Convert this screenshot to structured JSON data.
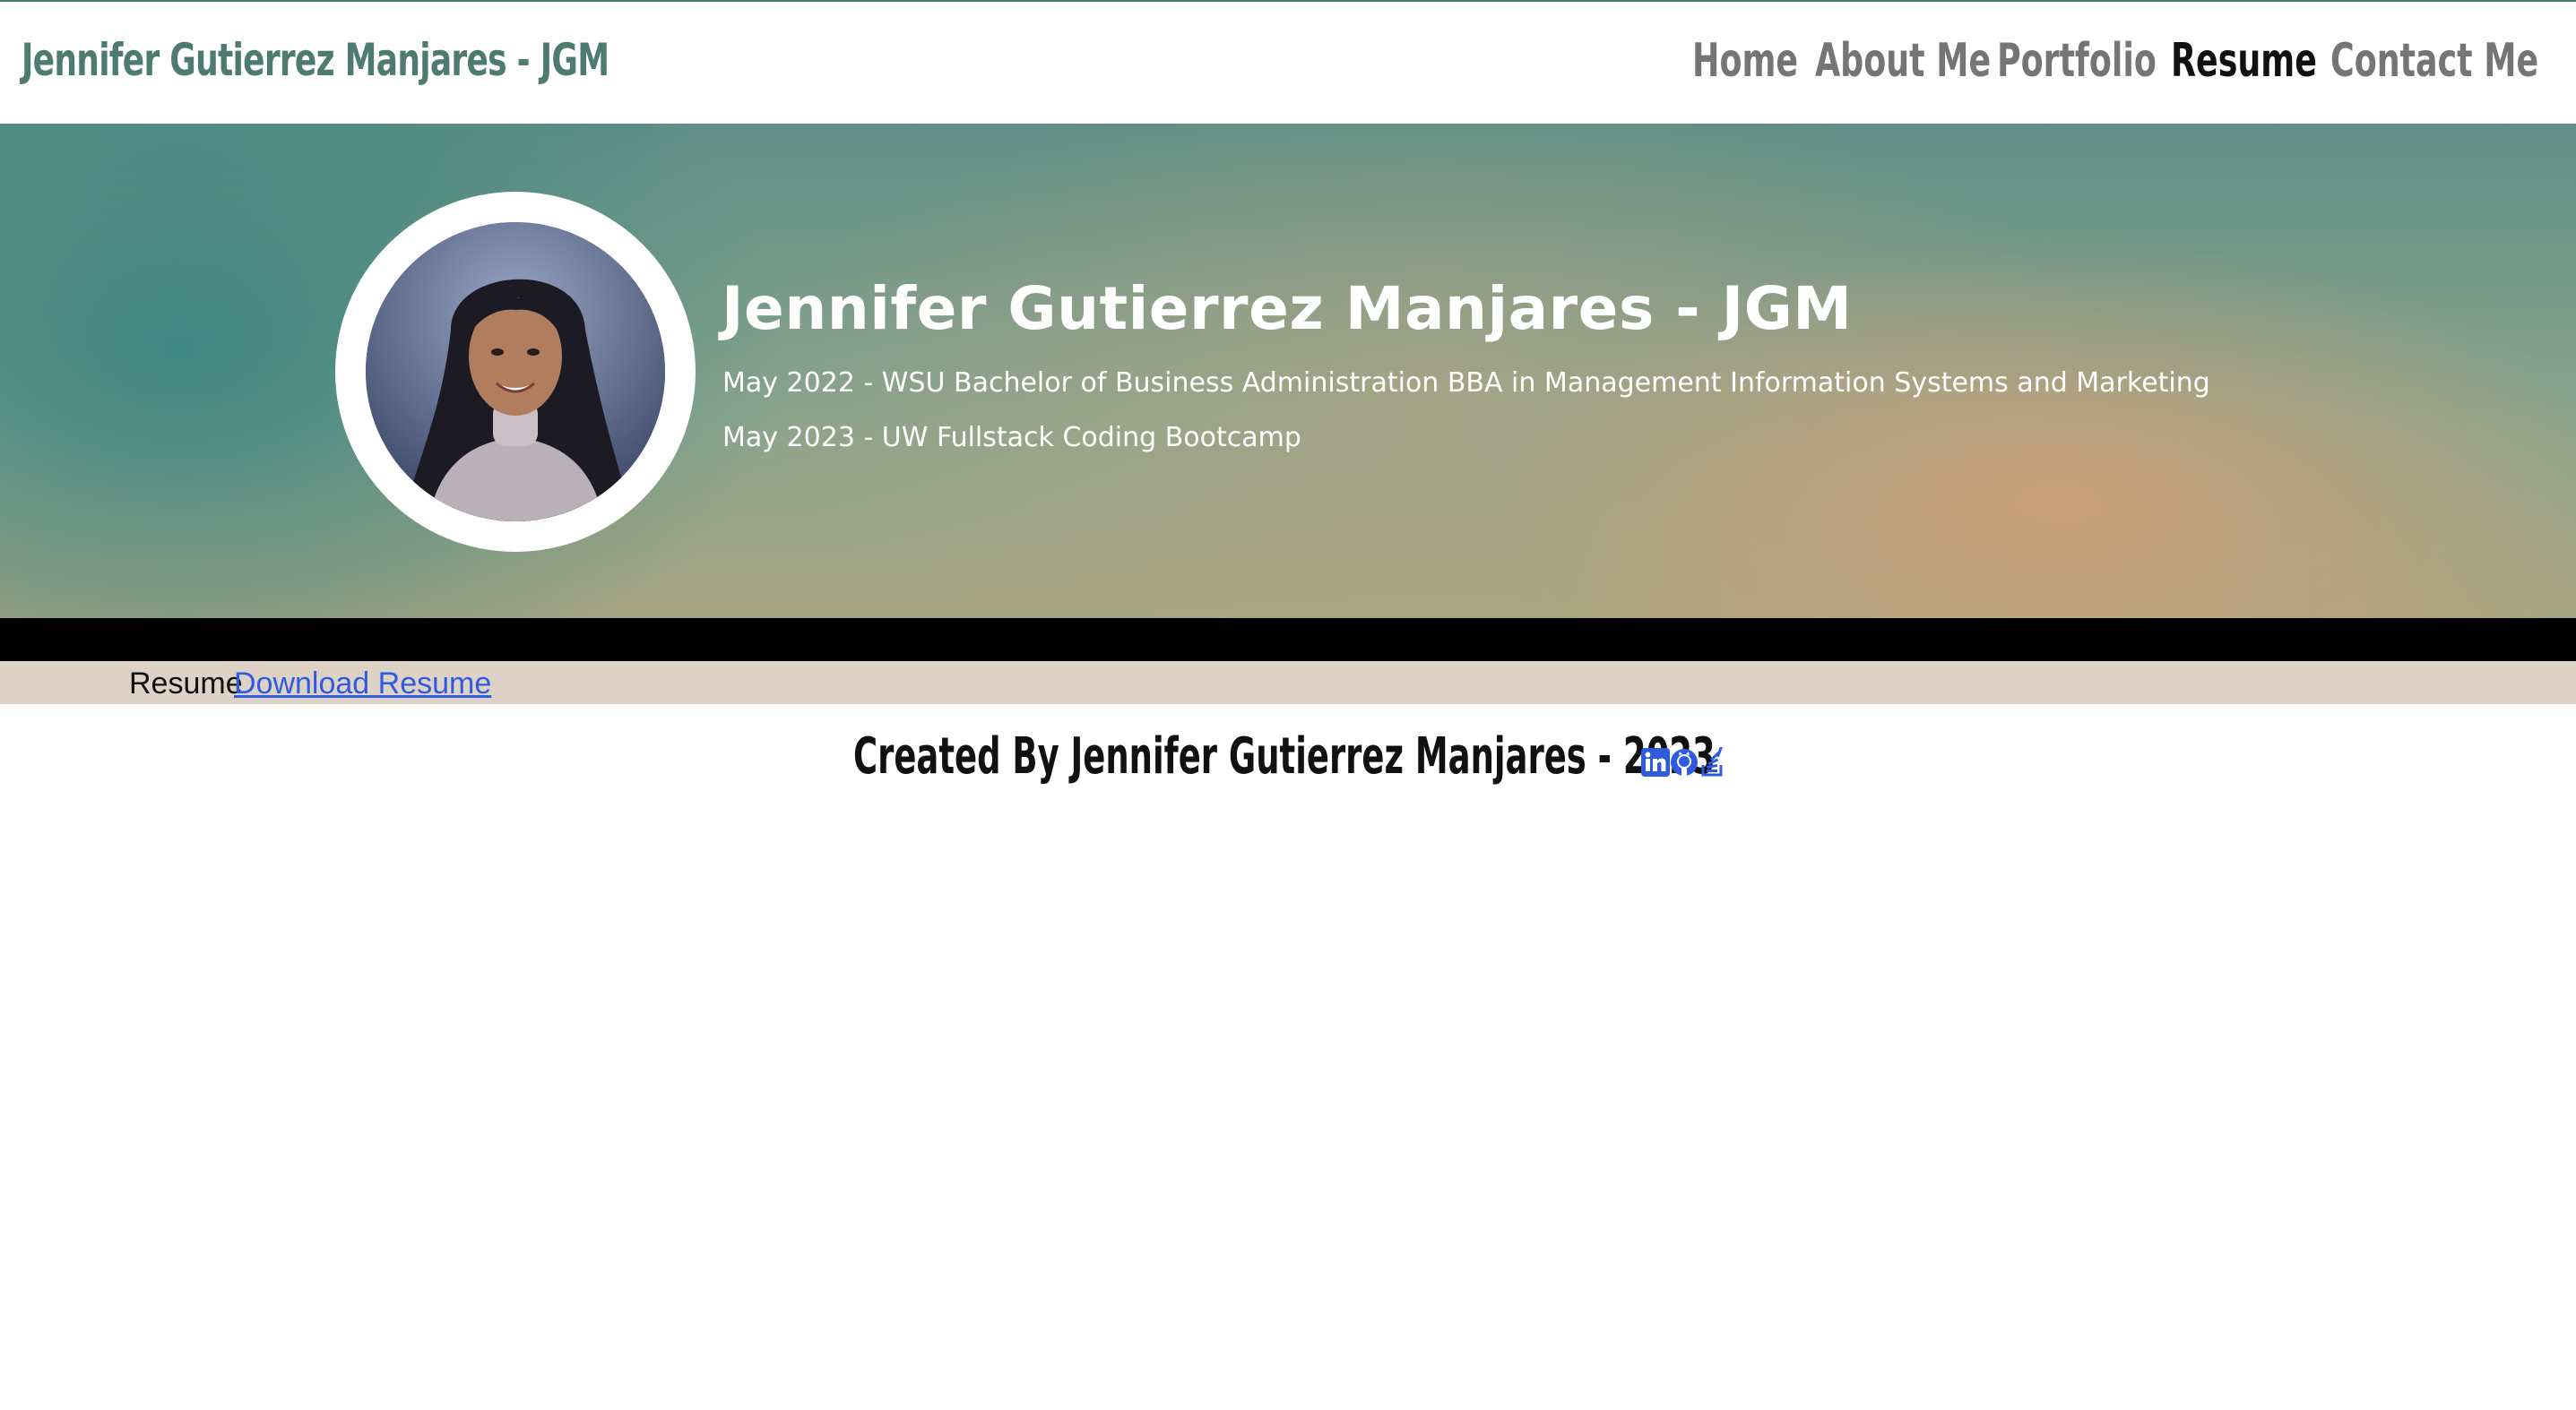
{
  "nav": {
    "brand": "Jennifer Gutierrez Manjares - JGM",
    "links": [
      {
        "label": "Home",
        "active": false
      },
      {
        "label": "About Me",
        "active": false
      },
      {
        "label": "Portfolio",
        "active": false
      },
      {
        "label": "Resume",
        "active": true
      },
      {
        "label": "Contact Me",
        "active": false
      }
    ]
  },
  "hero": {
    "title": "Jennifer Gutierrez Manjares - JGM",
    "education": [
      "May 2022 - WSU Bachelor of Business Administration BBA in Management Information Systems and Marketing",
      "May 2023 - UW Fullstack Coding Bootcamp"
    ]
  },
  "resume": {
    "label": "Resume",
    "download_label": "Download Resume"
  },
  "footer": {
    "text": "Created By Jennifer Gutierrez Manjares - 2023",
    "social": [
      {
        "name": "linkedin-icon"
      },
      {
        "name": "github-icon"
      },
      {
        "name": "stackoverflow-icon"
      }
    ]
  },
  "colors": {
    "brand": "#4d7b6f",
    "nav_inactive": "#757575",
    "nav_active": "#111111",
    "link": "#2e5be0",
    "resume_bar": "#ddd2c5",
    "social_icon": "#2e5be0"
  }
}
